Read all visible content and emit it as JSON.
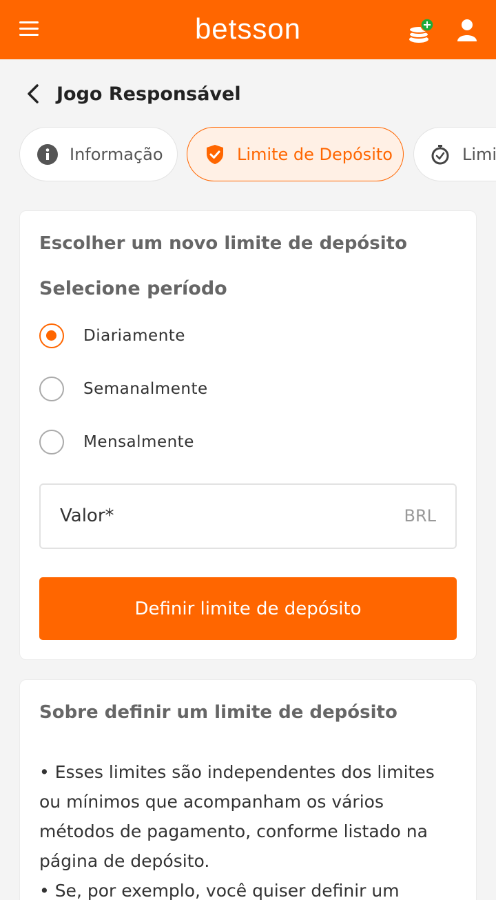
{
  "topbar": {
    "logo": "betsson",
    "menu_icon": "hamburger-menu-icon",
    "coins_icon": "coins-add-icon",
    "user_icon": "user-icon",
    "accent": "#ff6600"
  },
  "header": {
    "back_icon": "chevron-left-icon",
    "title": "Jogo Responsável"
  },
  "tabs": [
    {
      "label": "Informação",
      "icon": "info-icon",
      "active": false
    },
    {
      "label": "Limite de Depósito",
      "icon": "shield-icon",
      "active": true
    },
    {
      "label": "Limi",
      "icon": "stopwatch-icon",
      "active": false
    }
  ],
  "deposit_form": {
    "title": "Escolher um novo limite de depósito",
    "period_label": "Selecione período",
    "options": [
      {
        "label": "Diariamente",
        "checked": true
      },
      {
        "label": "Semanalmente",
        "checked": false
      },
      {
        "label": "Mensalmente",
        "checked": false
      }
    ],
    "amount_label": "Valor*",
    "amount_currency": "BRL",
    "submit_label": "Definir limite de depósito"
  },
  "about": {
    "title": "Sobre definir um limite de depósito",
    "paragraphs": [
      "• Esses limites são independentes dos limites ou mínimos que acompanham os vários métodos de pagamento, conforme listado na página de depósito.",
      "• Se, por exemplo, você quiser definir um"
    ]
  }
}
